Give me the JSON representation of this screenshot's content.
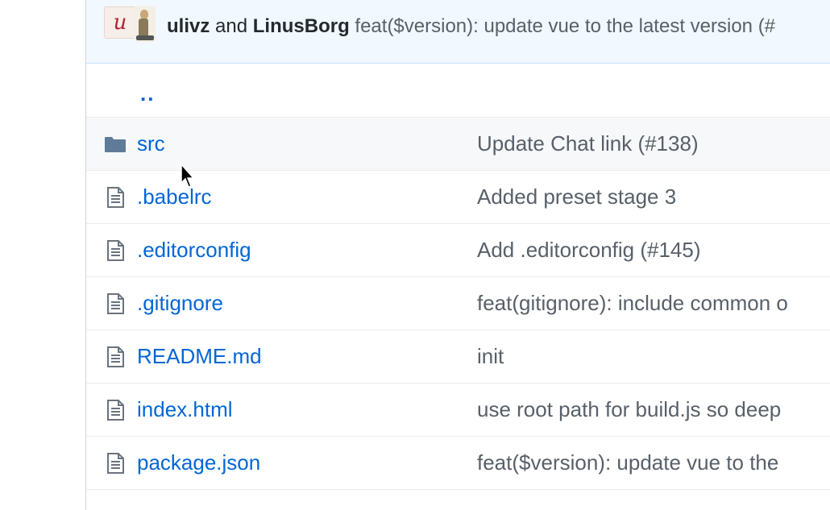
{
  "commit": {
    "author1": "ulivz",
    "joiner": "and",
    "author2": "LinusBorg",
    "message": "feat($version): update vue to the latest version (#",
    "avatar1_letter": "u"
  },
  "up_link": "..",
  "files": [
    {
      "name": "src",
      "type": "folder",
      "icon": "folder-icon",
      "message": "Update Chat link (#138)"
    },
    {
      "name": ".babelrc",
      "type": "file",
      "icon": "file-icon",
      "message": "Added preset stage 3"
    },
    {
      "name": ".editorconfig",
      "type": "file",
      "icon": "file-icon",
      "message": "Add .editorconfig (#145)"
    },
    {
      "name": ".gitignore",
      "type": "file",
      "icon": "file-icon",
      "message": "feat(gitignore): include common o"
    },
    {
      "name": "README.md",
      "type": "file",
      "icon": "file-icon",
      "message": "init"
    },
    {
      "name": "index.html",
      "type": "file",
      "icon": "file-icon",
      "message": "use root path for build.js so deep"
    },
    {
      "name": "package.json",
      "type": "file",
      "icon": "file-icon",
      "message": "feat($version): update vue to the"
    }
  ],
  "colors": {
    "link": "#0366d6",
    "header_bg": "#f1f8ff",
    "icon": "#6a737d",
    "folder": "#79b8ff"
  }
}
